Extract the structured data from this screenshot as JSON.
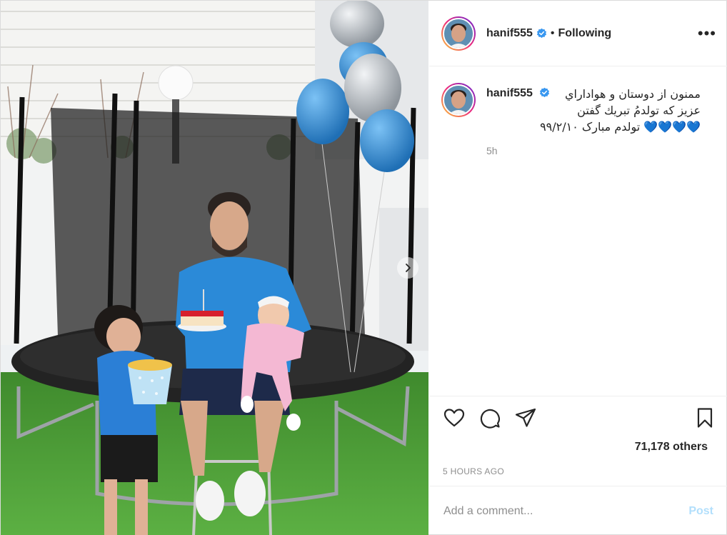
{
  "header": {
    "username": "hanif555",
    "separator": "•",
    "follow_status": "Following",
    "more_label": "•••"
  },
  "caption": {
    "username": "hanif555",
    "lines": [
      "ممنون از دوستان و هواداراي",
      "عزيز که تولدمُ تبريك گفتن",
      "💙💙💙💙 تولدم مبارک ۹۹/۲/۱۰"
    ],
    "time": "5h"
  },
  "actions": {
    "like_icon": "heart-icon",
    "comment_icon": "comment-icon",
    "share_icon": "share-icon",
    "save_icon": "bookmark-icon",
    "likes": "71,178 others",
    "timestamp": "5 HOURS AGO"
  },
  "comment": {
    "placeholder": "Add a comment...",
    "post_label": "Post"
  },
  "colors": {
    "verified": "#3897f0",
    "post_button": "#b2dffc",
    "muted": "#8e8e8e",
    "grass": "#4caf50",
    "balloon_blue": "#2f8fd6",
    "balloon_silver": "#b7bcc2",
    "shirt_blue": "#2b8ad8"
  }
}
